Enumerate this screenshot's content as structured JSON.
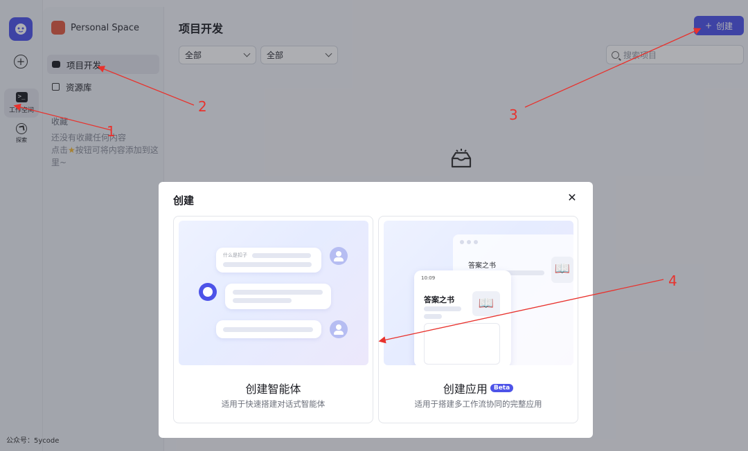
{
  "rail": {
    "workspace_label": "工作空间",
    "explore_label": "探索"
  },
  "sidebar": {
    "space_name": "Personal Space",
    "items": [
      {
        "label": "项目开发"
      },
      {
        "label": "资源库"
      }
    ],
    "favorites_title": "收藏",
    "favorites_empty_1": "还没有收藏任何内容",
    "favorites_empty_2": "点击",
    "favorites_empty_3": "按钮可将内容添加到这里~"
  },
  "main": {
    "title": "项目开发",
    "filter1": "全部",
    "filter2": "全部",
    "search_placeholder": "搜索项目",
    "create_label": "创建"
  },
  "modal": {
    "title": "创建",
    "cards": [
      {
        "name": "创建智能体",
        "desc": "适用于快速搭建对话式智能体",
        "art_text": "什么是扣子"
      },
      {
        "name": "创建应用",
        "badge": "Beta",
        "desc": "适用于搭建多工作流协同的完整应用",
        "art_book_title": "答案之书",
        "art_time": "10:09"
      }
    ]
  },
  "watermark": "公众号：5ycode",
  "annotations": [
    "1",
    "2",
    "3",
    "4"
  ],
  "colors": {
    "accent": "#4d53e8",
    "annotation": "#e8322d"
  }
}
